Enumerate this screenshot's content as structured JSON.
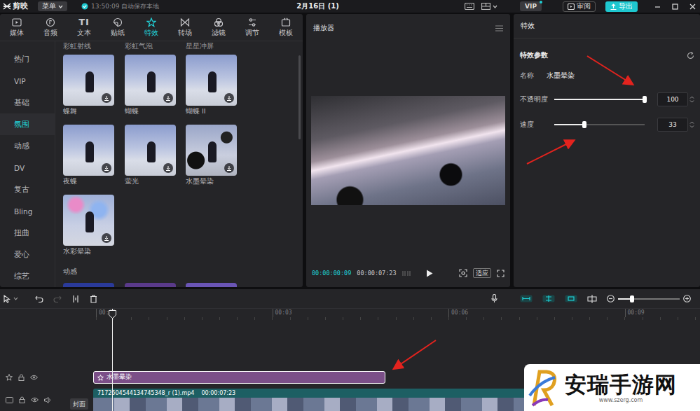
{
  "app": {
    "logo": "剪映",
    "menu": "菜单",
    "autosave": "13:50:09 自动保存本地",
    "title": "2月16日 (1)",
    "vip": "VIP",
    "review": "审阅",
    "export": "导出"
  },
  "tabs": [
    {
      "label": "媒体",
      "selected": false
    },
    {
      "label": "音频",
      "selected": false
    },
    {
      "label": "文本",
      "glyph": "TI",
      "selected": false
    },
    {
      "label": "贴纸",
      "selected": false
    },
    {
      "label": "特效",
      "selected": true
    },
    {
      "label": "转场",
      "selected": false
    },
    {
      "label": "滤镜",
      "selected": false
    },
    {
      "label": "调节",
      "selected": false
    },
    {
      "label": "模板",
      "selected": false
    }
  ],
  "categories": [
    {
      "label": "热门",
      "selected": false
    },
    {
      "label": "VIP",
      "selected": false
    },
    {
      "label": "基础",
      "selected": false
    },
    {
      "label": "氛围",
      "selected": true
    },
    {
      "label": "动感",
      "selected": false
    },
    {
      "label": "DV",
      "selected": false
    },
    {
      "label": "复古",
      "selected": false
    },
    {
      "label": "Bling",
      "selected": false
    },
    {
      "label": "扭曲",
      "selected": false
    },
    {
      "label": "爱心",
      "selected": false
    },
    {
      "label": "综艺",
      "selected": false
    }
  ],
  "effects_above": [
    "彩虹射线",
    "彩虹气泡",
    "星星冲屏"
  ],
  "effects": [
    {
      "name": "蝶舞",
      "kind": "light"
    },
    {
      "name": "蝴蝶",
      "kind": "light"
    },
    {
      "name": "蝴蝶 II",
      "kind": "light"
    },
    {
      "name": "夜蝶",
      "kind": "light"
    },
    {
      "name": "萤光",
      "kind": "light"
    },
    {
      "name": "水墨晕染",
      "kind": "ink"
    },
    {
      "name": "水彩晕染",
      "kind": "water"
    }
  ],
  "next_section": "动感",
  "player": {
    "title": "播放器",
    "current": "00:00:00:09",
    "total": "00:00:07:23",
    "fit": "适应"
  },
  "inspector": {
    "tab": "特效",
    "section": "特效参数",
    "name_label": "名称",
    "name_value": "水墨晕染",
    "params": [
      {
        "label": "不透明度",
        "level": 1.0,
        "value": "100"
      },
      {
        "label": "速度",
        "level": 0.33,
        "value": "33"
      }
    ]
  },
  "timeline": {
    "zoom_level": 0.23,
    "ticks": [
      "00:00",
      "00:03",
      "00:06",
      "00:09"
    ],
    "effect_clip": {
      "label": "水墨晕染",
      "selected": true
    },
    "video_clip": {
      "name": "7172604544134745348_r (1).mp4",
      "duration": "00:00:07:23"
    },
    "cover": "封面"
  },
  "watermark": {
    "name": "安瑞手游网",
    "url": "www.szerg.com"
  }
}
